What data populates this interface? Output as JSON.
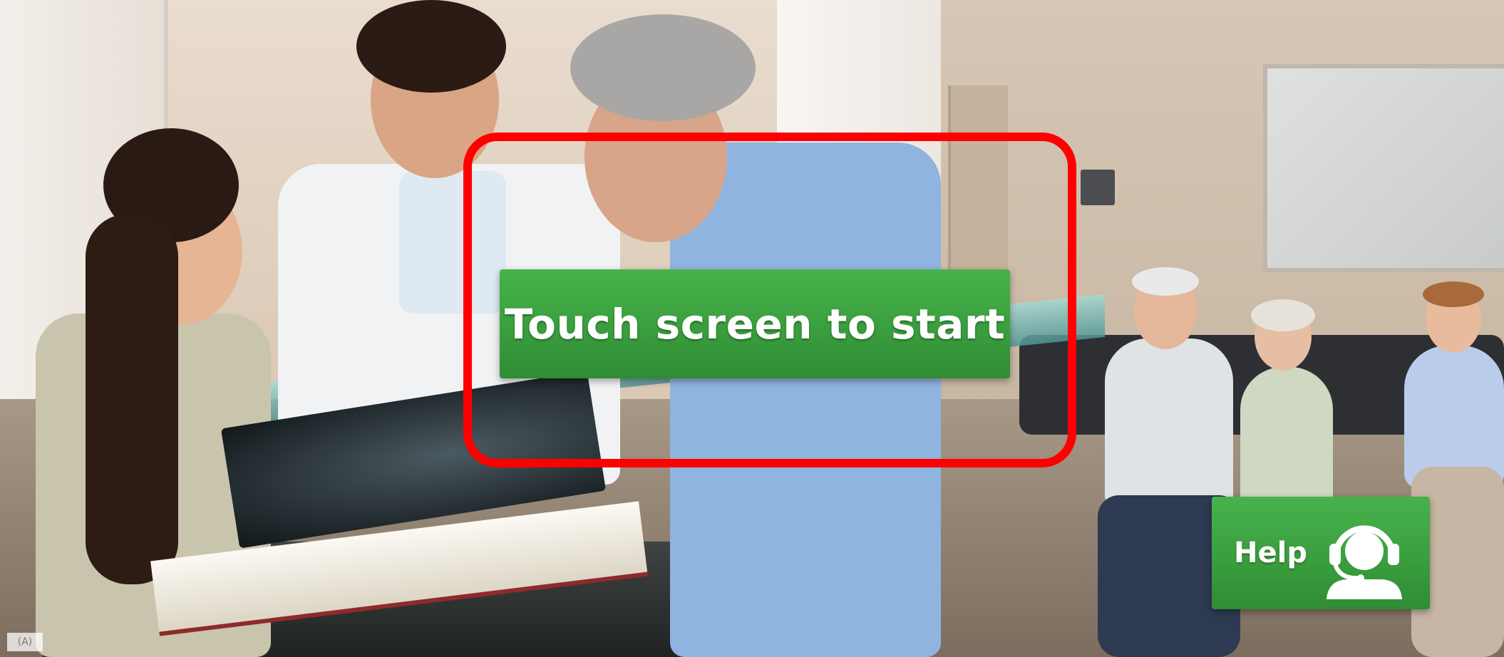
{
  "screen": {
    "start_button": {
      "label": "Touch screen to start"
    },
    "help_button": {
      "label": "Help",
      "icon": "headset-support-icon"
    },
    "watermark": "(A)",
    "colors": {
      "button_green": "#3a9f3e",
      "highlight_red": "#ff0000",
      "button_text": "#ffffff"
    }
  }
}
